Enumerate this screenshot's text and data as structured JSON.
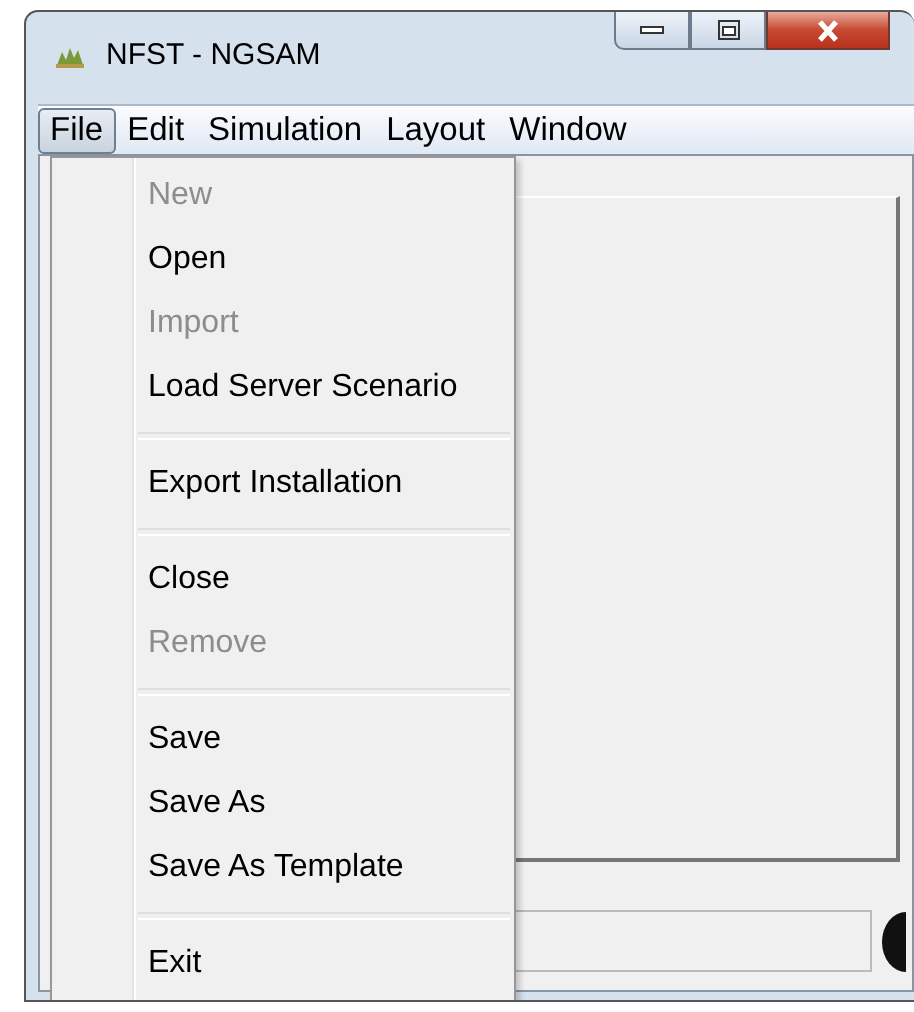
{
  "window": {
    "title": "NFST - NGSAM"
  },
  "menu_bar": [
    {
      "label": "File",
      "selected": true
    },
    {
      "label": "Edit",
      "selected": false
    },
    {
      "label": "Simulation",
      "selected": false
    },
    {
      "label": "Layout",
      "selected": false
    },
    {
      "label": "Window",
      "selected": false
    }
  ],
  "file_menu": {
    "sections": [
      [
        {
          "label": "New",
          "disabled": true
        },
        {
          "label": "Open",
          "disabled": false
        },
        {
          "label": "Import",
          "disabled": true
        },
        {
          "label": "Load Server Scenario",
          "disabled": false
        }
      ],
      [
        {
          "label": "Export Installation",
          "disabled": false
        }
      ],
      [
        {
          "label": "Close",
          "disabled": false
        },
        {
          "label": "Remove",
          "disabled": true
        }
      ],
      [
        {
          "label": "Save",
          "disabled": false
        },
        {
          "label": "Save As",
          "disabled": false
        },
        {
          "label": "Save As Template",
          "disabled": false
        }
      ],
      [
        {
          "label": "Exit",
          "disabled": false
        }
      ]
    ]
  }
}
